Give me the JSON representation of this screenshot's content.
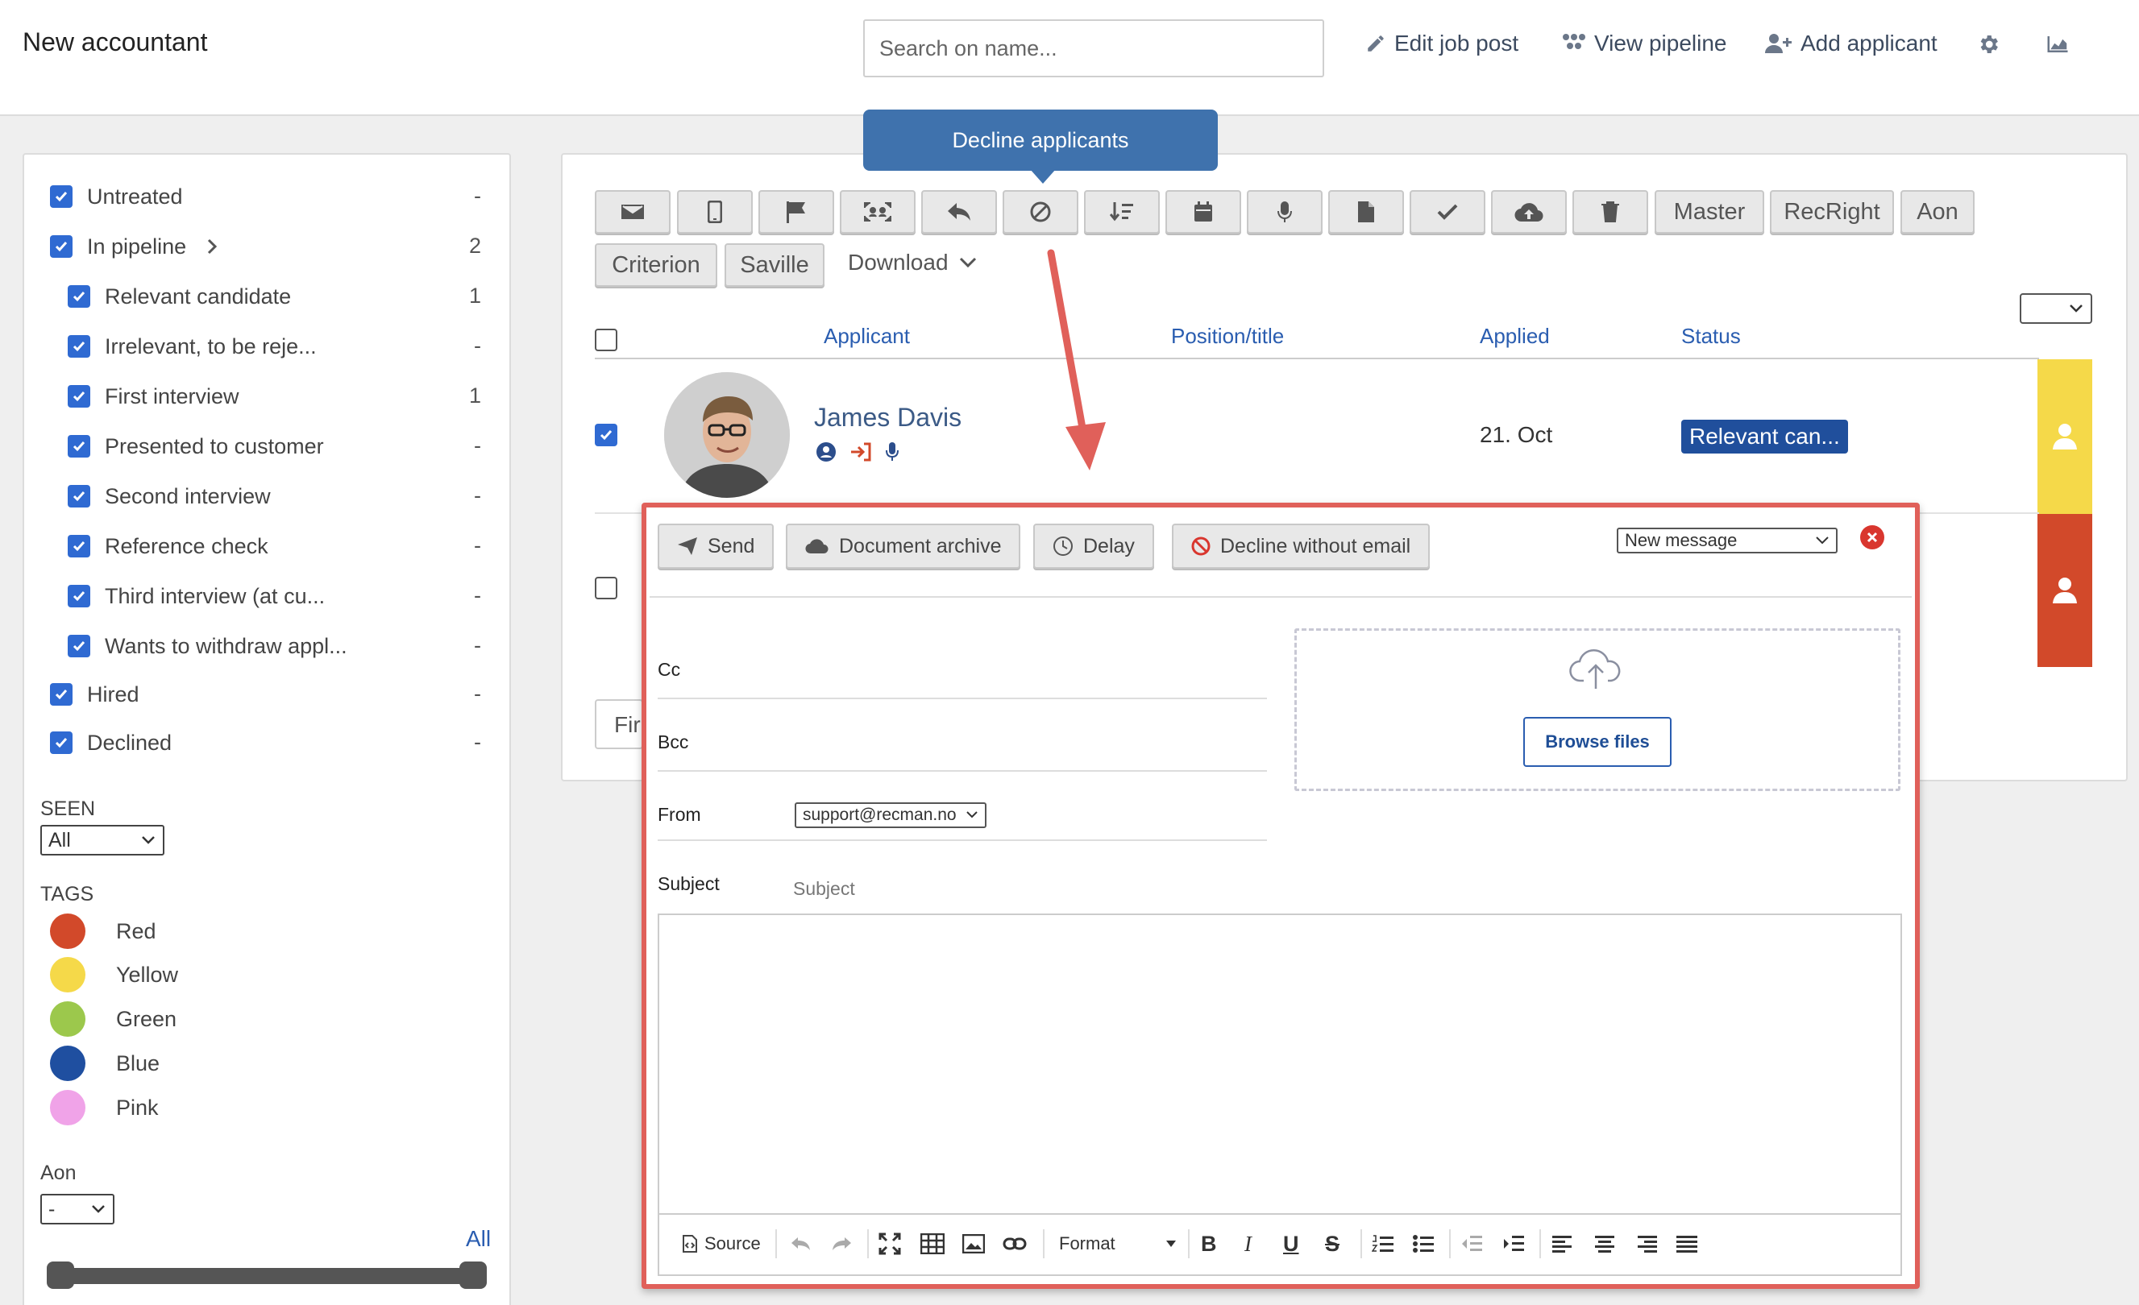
{
  "header": {
    "title": "New accountant",
    "search_placeholder": "Search on name...",
    "edit_job_post": "Edit job post",
    "view_pipeline": "View pipeline",
    "add_applicant": "Add applicant",
    "settings_icon": "gear-icon",
    "stats_icon": "chart-icon"
  },
  "filters": {
    "statuses": [
      {
        "label": "Untreated",
        "count": "-",
        "checked": true
      },
      {
        "label": "In pipeline",
        "count": "2",
        "checked": true
      },
      {
        "label": "Relevant candidate",
        "count": "1",
        "checked": true
      },
      {
        "label": "Irrelevant, to be reje...",
        "count": "-",
        "checked": true
      },
      {
        "label": "First interview",
        "count": "1",
        "checked": true
      },
      {
        "label": "Presented to customer",
        "count": "-",
        "checked": true
      },
      {
        "label": "Second interview",
        "count": "-",
        "checked": true
      },
      {
        "label": "Reference check",
        "count": "-",
        "checked": true
      },
      {
        "label": "Third interview (at cu...",
        "count": "-",
        "checked": true
      },
      {
        "label": "Wants to withdraw appl...",
        "count": "-",
        "checked": true
      },
      {
        "label": "Hired",
        "count": "-",
        "checked": true
      },
      {
        "label": "Declined",
        "count": "-",
        "checked": true
      }
    ],
    "seen_label": "SEEN",
    "seen_value": "All",
    "tags_label": "TAGS",
    "tags": [
      {
        "label": "Red",
        "color": "#d2492a"
      },
      {
        "label": "Yellow",
        "color": "#f5d949"
      },
      {
        "label": "Green",
        "color": "#9cc84c"
      },
      {
        "label": "Blue",
        "color": "#1f4fa0"
      },
      {
        "label": "Pink",
        "color": "#f0a3e8"
      }
    ],
    "aon_label": "Aon",
    "aon_value": "-",
    "all_link": "All"
  },
  "toolbar": {
    "icon_buttons": [
      "email-icon",
      "mobile-icon",
      "flag-icon",
      "scan-icon",
      "reply-icon",
      "decline-icon",
      "sort-icon",
      "calendar-icon",
      "microphone-icon",
      "document-icon",
      "check-icon",
      "cloud-upload-icon",
      "trash-icon"
    ],
    "text_buttons": [
      "Master",
      "RecRight",
      "Aon",
      "Criterion",
      "Saville"
    ],
    "download": "Download",
    "tooltip": "Decline applicants"
  },
  "table": {
    "columns": [
      "Applicant",
      "Position/title",
      "Applied",
      "Status"
    ],
    "rows": [
      {
        "name": "James Davis",
        "applied": "21. Oct",
        "status": "Relevant can...",
        "tag_color": "#f5d949",
        "checked": true
      },
      {
        "name": "",
        "applied": "",
        "status": "",
        "tag_color": "#d2492a",
        "checked": false
      }
    ],
    "footer_button": "Fir"
  },
  "modal": {
    "send": "Send",
    "document_archive": "Document archive",
    "delay": "Delay",
    "decline_without_email": "Decline without email",
    "message_template": "New message",
    "cc_label": "Cc",
    "bcc_label": "Bcc",
    "from_label": "From",
    "from_value": "support@recman.no",
    "subject_label": "Subject",
    "subject_placeholder": "Subject",
    "browse_files": "Browse files",
    "editor": {
      "source": "Source",
      "format": "Format"
    }
  },
  "colors": {
    "accent": "#2f6ad2",
    "tooltip": "#3f72ad",
    "status_badge": "#204f9c",
    "modal_border": "#e0605a",
    "annotation_arrow": "#e0605a"
  }
}
